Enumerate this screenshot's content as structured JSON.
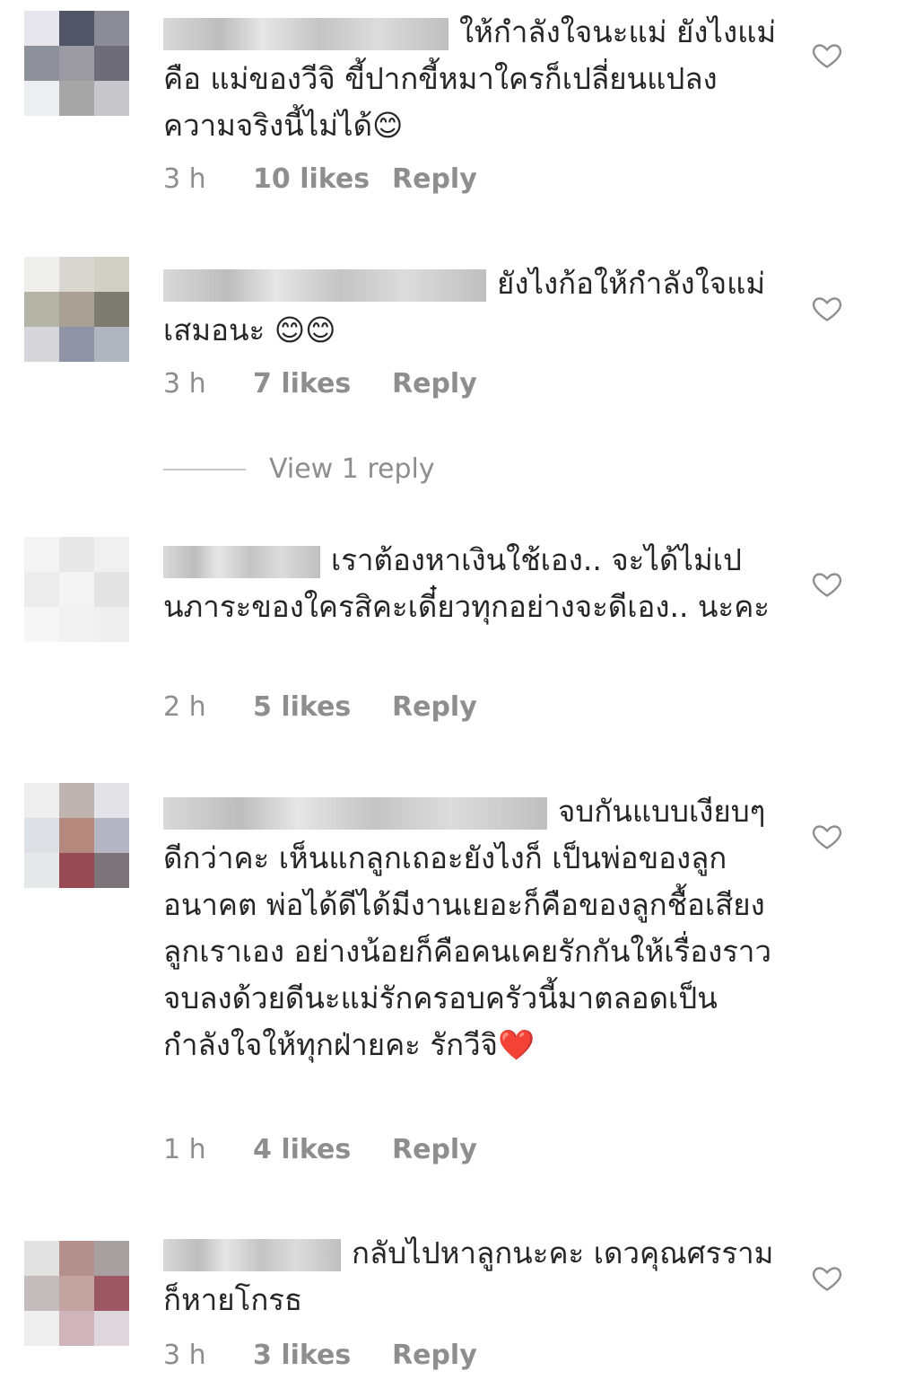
{
  "comments": [
    {
      "text": "ให้กำลังใจนะแม่ ยังไงแม่คือ แม่ของวีจิ ขี้ปากขี้หมาใครก็เปลี่ยนแปลงความจริงนี้ไม่ได้😊",
      "time": "3 h",
      "likes": "10 likes",
      "reply": "Reply"
    },
    {
      "text": "ยังไงก้อให้กำลังใจแม่เสมอนะ 😊😊",
      "time": "3 h",
      "likes": "7 likes",
      "reply": "Reply"
    },
    {
      "text": "เราต้องหาเงินใช้เอง.. จะได้ไม่เปนภาระของใครสิคะเดี๋ยวทุกอย่างจะดีเอง.. นะคะ",
      "time": "2 h",
      "likes": "5 likes",
      "reply": "Reply"
    },
    {
      "text": "จบกันแบบเงียบๆดีกว่าคะ เห็นแกลูกเถอะยังไงก็ เป็นพ่อของลูกอนาคต พ่อได้ดีได้มีงานเยอะก็คือของลูกชื้อเสียงลูกเราเอง อย่างน้อยก็คือคนเคยรักกันให้เรื่องราวจบลงด้วยดีนะแม่รักครอบครัวนี้มาตลอดเป็นกำลังใจให้ทุกฝ่ายคะ รักวีจิ❤️",
      "time": "1 h",
      "likes": "4 likes",
      "reply": "Reply"
    },
    {
      "text": "กลับไปหาลูกนะคะ เดวคุณศรรามก็หายโกรธ",
      "time": "3 h",
      "likes": "3 likes",
      "reply": "Reply"
    }
  ],
  "view_replies": "View 1 reply",
  "icons": {
    "like": "heart-outline-icon"
  },
  "colors": {
    "meta": "#8e8e8e",
    "text": "#262626"
  }
}
